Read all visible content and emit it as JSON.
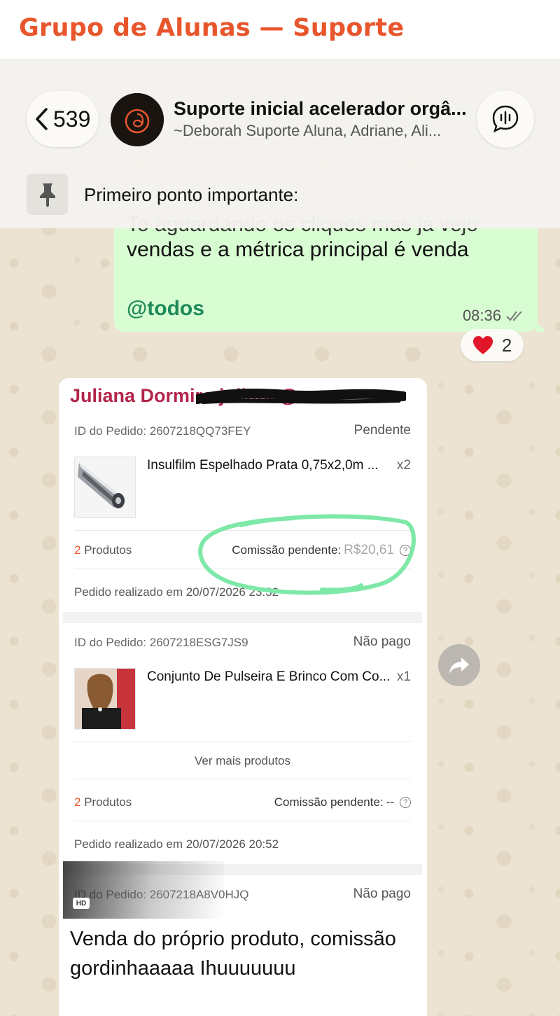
{
  "page_title": "Grupo de Alunas — Suporte",
  "header": {
    "back_count": "539",
    "group_name": "Suporte inicial acelerador orgâ...",
    "participants": "~Deborah Suporte Aluna, Adriane, Ali...",
    "pinned_message": "Primeiro ponto importante:"
  },
  "outgoing_message": {
    "line_cut": "To aguardando os cliques mas já vejo",
    "line": "vendas e a métrica principal é venda",
    "mention": "@todos",
    "time": "08:36",
    "reaction_emoji": "❤️",
    "reaction_count": "2"
  },
  "incoming_message": {
    "sender": "Juliana Dormiro juliana@...",
    "orders": [
      {
        "id": "ID do Pedido: 2607218QQ73FEY",
        "status": "Pendente",
        "product": "Insulfilm Espelhado Prata 0,75x2,0m ...",
        "qty": "x2",
        "count_num": "2",
        "count_label": " Produtos",
        "commission_label": "Comissão pendente:",
        "commission_value": "R$20,61",
        "date": "Pedido realizado em 20/07/2026 23:32"
      },
      {
        "id": "ID do Pedido: 2607218ESG7JS9",
        "status": "Não pago",
        "product": "Conjunto De Pulseira E Brinco Com Co...",
        "qty": "x1",
        "more": "Ver mais produtos",
        "count_num": "2",
        "count_label": " Produtos",
        "commission_label": "Comissão pendente:",
        "commission_value": "--",
        "date": "Pedido realizado em 20/07/2026 20:52"
      },
      {
        "id": "ID do Pedido: 2607218A8V0HJQ",
        "status": "Não pago"
      }
    ],
    "hd_badge": "HD",
    "caption": "Venda do próprio produto, comissão gordinhaaaaa Ihuuuuuuu"
  },
  "colors": {
    "title": "#e8562c",
    "outgoing_bubble": "#d9fdd3",
    "mention": "#1f8a5a",
    "sender": "#b3254a",
    "highlight_circle": "#7ee8a8"
  }
}
